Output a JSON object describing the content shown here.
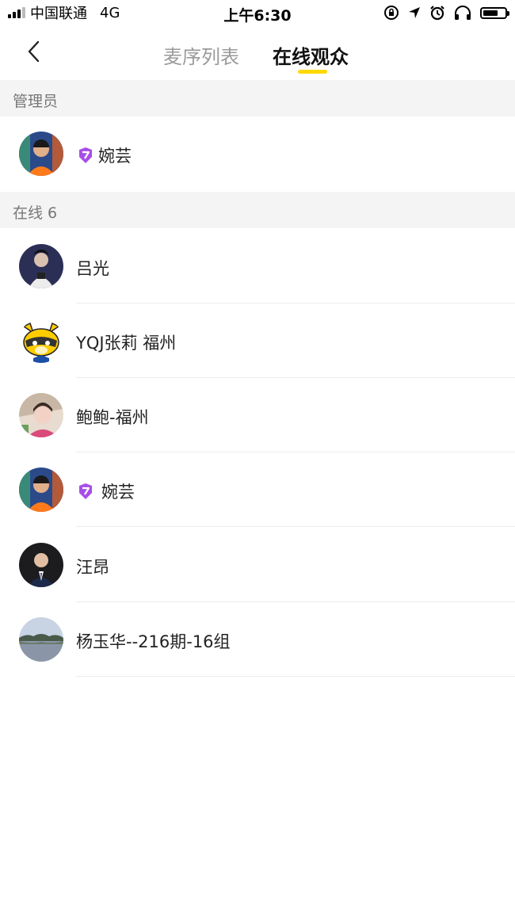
{
  "status_bar": {
    "carrier": "中国联通",
    "network": "4G",
    "time": "上午6:30"
  },
  "nav": {
    "back_icon": "chevron-left-icon",
    "tabs": [
      {
        "label": "麦序列表",
        "active": false
      },
      {
        "label": "在线观众",
        "active": true
      }
    ],
    "accent_color": "#ffd900"
  },
  "sections": {
    "admins": {
      "label": "管理员"
    },
    "online": {
      "label": "在线 6"
    }
  },
  "admins": [
    {
      "name": "婉芸",
      "badge": "purple-gem-badge-icon"
    }
  ],
  "online_users": [
    {
      "name": "吕光"
    },
    {
      "name": "YQJ张莉 福州"
    },
    {
      "name": "鲍鲍-福州"
    },
    {
      "name": "婉芸",
      "badge": "purple-gem-badge-icon"
    },
    {
      "name": "汪昂"
    },
    {
      "name": "杨玉华--216期-16组"
    }
  ]
}
